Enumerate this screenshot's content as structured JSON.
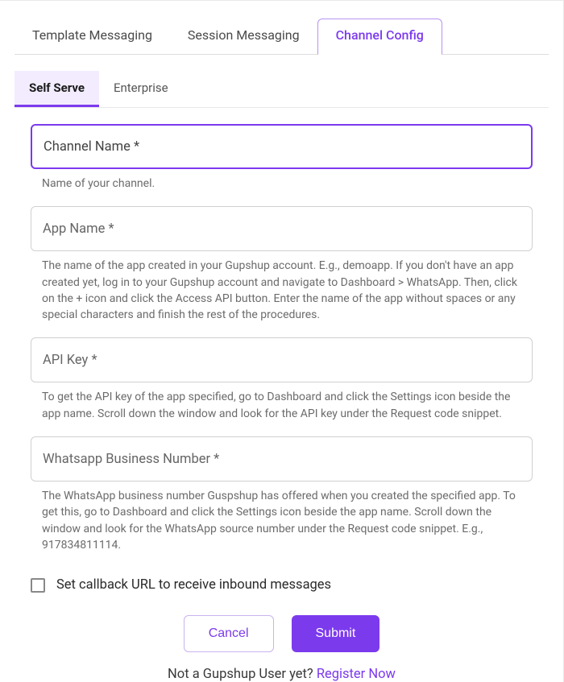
{
  "mainTabs": {
    "templateMessaging": "Template Messaging",
    "sessionMessaging": "Session Messaging",
    "channelConfig": "Channel Config"
  },
  "subTabs": {
    "selfServe": "Self Serve",
    "enterprise": "Enterprise"
  },
  "form": {
    "channelName": {
      "label": "Channel Name *",
      "helper": "Name of your channel."
    },
    "appName": {
      "label": "App Name *",
      "helper": "The name of the app created in your Gupshup account. E.g., demoapp. If you don't have an app created yet, log in to your Gupshup account and navigate to Dashboard > WhatsApp. Then, click on the + icon and click the Access API button. Enter the name of the app without spaces or any special characters and finish the rest of the procedures."
    },
    "apiKey": {
      "label": "API Key *",
      "helper": "To get the API key of the app specified, go to Dashboard and click the Settings icon beside the app name. Scroll down the window and look for the API key under the Request code snippet."
    },
    "whatsappNumber": {
      "label": "Whatsapp Business Number *",
      "helper": "The WhatsApp business number Guspshup has offered when you created the specified app. To get this, go to Dashboard and click the Settings icon beside the app name. Scroll down the window and look for the WhatsApp source number under the Request code snippet. E.g., 917834811114."
    },
    "callbackCheckbox": "Set callback URL to receive inbound messages"
  },
  "buttons": {
    "cancel": "Cancel",
    "submit": "Submit"
  },
  "footer": {
    "prompt": "Not a Gupshup User yet? ",
    "link": "Register Now"
  },
  "colors": {
    "accent": "#7c3aed",
    "accentLight": "#f3ecff",
    "border": "#d0d0d0",
    "textMuted": "#6b6b6b"
  }
}
